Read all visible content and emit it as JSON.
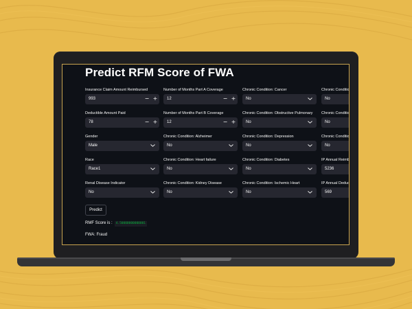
{
  "app": {
    "title": "Predict RFM Score of FWA"
  },
  "columns": [
    {
      "fields": [
        {
          "label": "Insurance Claim Amount Reimbursed",
          "type": "number",
          "value": "993"
        },
        {
          "label": "Deductible Amount Paid",
          "type": "number",
          "value": "78"
        },
        {
          "label": "Gender",
          "type": "select",
          "value": "Male"
        },
        {
          "label": "Race",
          "type": "select",
          "value": "Race1"
        },
        {
          "label": "Renal Disease Indicator",
          "type": "select",
          "value": "No"
        }
      ]
    },
    {
      "fields": [
        {
          "label": "Number of Months Part A Coverage",
          "type": "number",
          "value": "12"
        },
        {
          "label": "Number of Months Part B Coverage",
          "type": "number",
          "value": "12"
        },
        {
          "label": "Chronic Condition: Alzheimer",
          "type": "select",
          "value": "No"
        },
        {
          "label": "Chronic Condition: Heart failure",
          "type": "select",
          "value": "No"
        },
        {
          "label": "Chronic Condition: Kidney Disease",
          "type": "select",
          "value": "No"
        }
      ]
    },
    {
      "fields": [
        {
          "label": "Chronic Condition: Cancer",
          "type": "select",
          "value": "No"
        },
        {
          "label": "Chronic Condition: Obstructive Pulmonary",
          "type": "select",
          "value": "No"
        },
        {
          "label": "Chronic Condition: Depression",
          "type": "select",
          "value": "No"
        },
        {
          "label": "Chronic Condition: Diabetes",
          "type": "select",
          "value": "No"
        },
        {
          "label": "Chronic Condition: Ischemic Heart",
          "type": "select",
          "value": "No"
        }
      ]
    },
    {
      "fields": [
        {
          "label": "Chronic Conditio",
          "type": "select",
          "value": "No"
        },
        {
          "label": "Chronic Conditio",
          "type": "select",
          "value": "No"
        },
        {
          "label": "Chronic Conditio",
          "type": "select",
          "value": "No"
        },
        {
          "label": "IP Annual Reimbu",
          "type": "number",
          "value": "5236"
        },
        {
          "label": "IP Annual Deduct",
          "type": "number",
          "value": "569"
        }
      ]
    }
  ],
  "stepper": {
    "minus": "−",
    "plus": "+"
  },
  "actions": {
    "predict_label": "Predict"
  },
  "result": {
    "score_label": "RMF Score is :",
    "score_value": "4.50000000000001",
    "fwa_text": "FWA: Fraud"
  },
  "colors": {
    "background": "#e7b94c",
    "app_bg": "#0e1117",
    "widget_bg": "#262730",
    "score_green": "#09ab3b"
  }
}
